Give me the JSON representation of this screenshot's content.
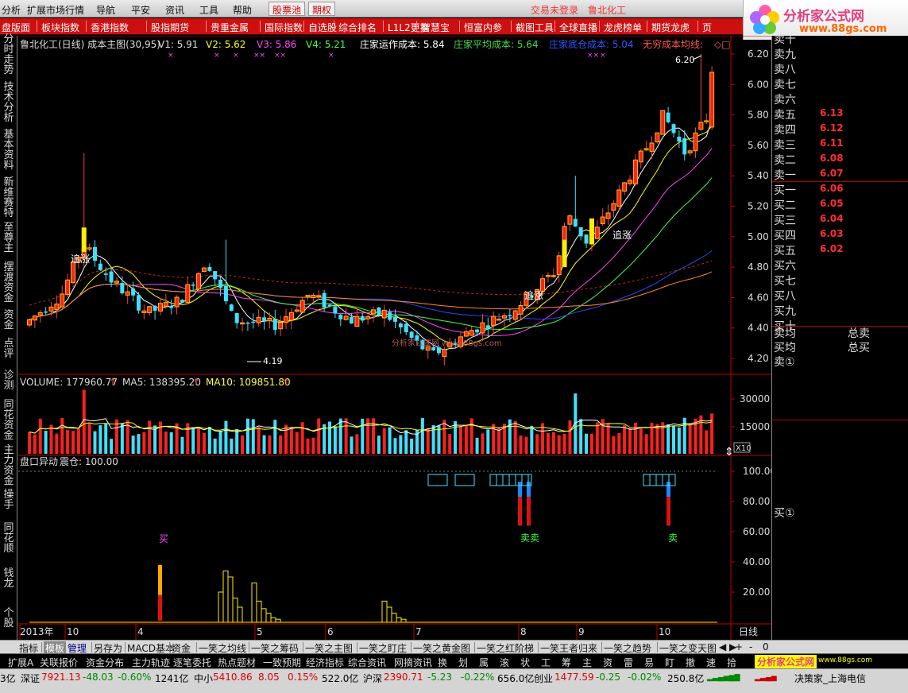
{
  "menu": {
    "items": [
      "分析",
      "扩展市场行情",
      "导航",
      "平安",
      "资讯",
      "工具",
      "帮助"
    ],
    "tabs": [
      "股票池",
      "期权"
    ],
    "status": "交易未登录",
    "stock_name": "鲁北化工"
  },
  "logo": {
    "title": "分析家公式网",
    "url": "www.88gs.com"
  },
  "navbar": [
    "盘版面",
    "板块指数",
    "香港指数",
    "股指期货",
    "贵重金属",
    "国际指数",
    "自选股",
    "综合排名",
    "L1L2更换",
    "智慧宝",
    "恒富内参",
    "截图工具",
    "全球直播",
    "龙虎榜单",
    "期货龙虎",
    "页"
  ],
  "leftbar": [
    "分时走势",
    "技术分析",
    "基本资料",
    "新维赛特",
    "至尊主",
    "摆渡资金",
    "资金",
    "点评",
    "诊测",
    "同花资金",
    "主力资金",
    "操手",
    "同花顺",
    "钱龙",
    "个股"
  ],
  "chart": {
    "main_title": "鲁北化工(日线) 成本主图(30,95)",
    "v_labels": [
      "V1: 5.91",
      "V2: 5.62",
      "V3: 5.86",
      "V4: 5.21"
    ],
    "cost_labels": [
      "庄家运作成本: 5.84",
      "庄家平均成本: 5.64",
      "庄家底仓成本: 5.04",
      "无穷成本均线:"
    ],
    "price_axis": [
      "6.20",
      "6.00",
      "5.80",
      "5.60",
      "5.40",
      "5.20",
      "5.00",
      "4.80",
      "4.60",
      "4.40",
      "4.20"
    ],
    "max_label": "6.20",
    "min_label": "4.19",
    "signal_labels": [
      "追涨",
      "追涨",
      "追涨"
    ],
    "watermark": "分析家公式网 www.88gs.com",
    "volume_title": "VOLUME: 177960.77",
    "ma5": "MA5: 138395.20",
    "ma10": "MA10: 109851.80",
    "vol_axis": [
      "30000",
      "15000"
    ],
    "vol_unit": "X10",
    "sub_title": "盘口异动",
    "sub_param": "震仓: 100.00",
    "sub_axis": [
      "100.00",
      "80.00",
      "60.00",
      "40.00",
      "20.00"
    ],
    "sub_buy": "买",
    "sub_sell": [
      "卖卖",
      "卖"
    ],
    "months": [
      "2013年",
      "10",
      "4",
      "5",
      "6",
      "7",
      "8",
      "9",
      "10"
    ],
    "period": "日线",
    "zoom": [
      "+",
      "-",
      "0"
    ]
  },
  "chart_data": {
    "type": "candlestick",
    "period": "daily",
    "price_range": [
      4.19,
      6.2
    ],
    "volume_range": [
      0,
      30000
    ],
    "indicator_range": [
      0,
      100
    ],
    "moving_averages": {
      "V1": 5.91,
      "V2": 5.62,
      "V3": 5.86,
      "V4": 5.21
    },
    "cost_lines": {
      "庄家运作成本": 5.84,
      "庄家平均成本": 5.64,
      "庄家底仓成本": 5.04
    }
  },
  "orderbook": {
    "sell": [
      {
        "label": "卖十",
        "price": ""
      },
      {
        "label": "卖九",
        "price": ""
      },
      {
        "label": "卖八",
        "price": ""
      },
      {
        "label": "卖七",
        "price": ""
      },
      {
        "label": "卖六",
        "price": ""
      },
      {
        "label": "卖五",
        "price": "6.13"
      },
      {
        "label": "卖四",
        "price": "6.12"
      },
      {
        "label": "卖三",
        "price": "6.11"
      },
      {
        "label": "卖二",
        "price": "6.08"
      },
      {
        "label": "卖一",
        "price": "6.07"
      }
    ],
    "buy": [
      {
        "label": "买一",
        "price": "6.06"
      },
      {
        "label": "买二",
        "price": "6.05"
      },
      {
        "label": "买三",
        "price": "6.04"
      },
      {
        "label": "买四",
        "price": "6.03"
      },
      {
        "label": "买五",
        "price": "6.02"
      },
      {
        "label": "买六",
        "price": ""
      },
      {
        "label": "买七",
        "price": ""
      },
      {
        "label": "买八",
        "price": ""
      },
      {
        "label": "买九",
        "price": ""
      },
      {
        "label": "买十",
        "price": ""
      }
    ],
    "sell_avg": "卖均",
    "buy_avg": "买均",
    "sell_total": "总卖",
    "buy_total": "总买",
    "sell_circle": "卖①",
    "buy_circle": "买①"
  },
  "tabs": [
    "指标",
    "模板",
    "管理",
    "另存为",
    "MACD基本",
    "资金",
    "一笑之均线",
    "一笑之筹码",
    "一笑之主图",
    "一笑之盯庄",
    "一笑之黄金图",
    "一笑之红阶梯",
    "一笑王者归来",
    "一笑之趋势",
    "一笑之变天图"
  ],
  "fnbar": [
    "扩展A",
    "关联报价",
    "资金分布",
    "主力轨迹",
    "逐笔委托",
    "热点题材",
    "一致预期",
    "经济指标",
    "综合资讯",
    "网摘资讯",
    "换",
    "划",
    "属",
    "滚",
    "状",
    "工",
    "筹",
    "主",
    "资",
    "雷",
    "易",
    "盯",
    "撤",
    "速",
    "拾"
  ],
  "fnbar_logo": "分析家公式网",
  "fnbar_url": "www.88gs.com",
  "ticker": {
    "a": "3亿",
    "sz_label": "深证",
    "sz_val": "7921.13",
    "sz_chg": "-48.03",
    "sz_pct": "-0.60%",
    "sz_amt": "1241亿",
    "zx_label": "中小",
    "zx_val": "5410.86",
    "zx_chg": "8.05",
    "zx_pct": "0.15%",
    "zx_amt": "522.0亿",
    "hs_label": "沪深",
    "hs_val": "2390.71",
    "hs_chg": "-5.23",
    "hs_pct": "-0.22%",
    "hs_amt": "656.0亿",
    "cy_label": "创业",
    "cy_val": "1477.59",
    "cy_chg": "-0.25",
    "cy_pct": "-0.02%",
    "cy_amt": "250.8亿",
    "broker": "决策家_上海电信"
  }
}
